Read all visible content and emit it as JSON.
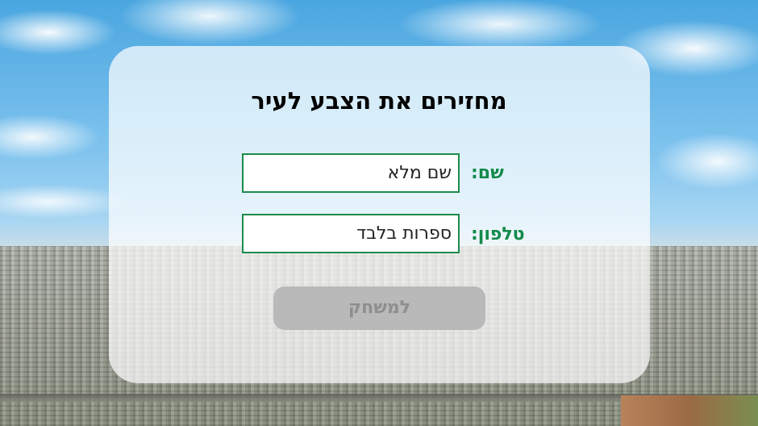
{
  "form": {
    "title": "מחזירים את הצבע לעיר",
    "name_label": "שם:",
    "name_placeholder": "שם מלא",
    "phone_label": "טלפון:",
    "phone_placeholder": "ספרות בלבד",
    "play_button_label": "למשחק"
  },
  "colors": {
    "label_green": "#128a4a",
    "input_border": "#1c8b4c",
    "button_disabled_bg": "#b9b9b9",
    "button_disabled_text": "#8e8e8e"
  }
}
